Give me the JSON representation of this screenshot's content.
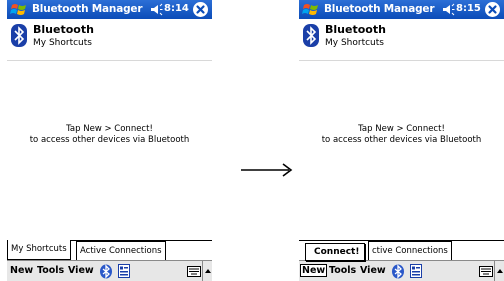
{
  "before": {
    "title": "Bluetooth Manager",
    "time": "8:14",
    "heading": "Bluetooth",
    "subheading": "My Shortcuts",
    "tip_line1": "Tap New > Connect!",
    "tip_line2": "to access other devices via Bluetooth",
    "tabs": [
      "My Shortcuts",
      "Active Connections"
    ],
    "menu": [
      "New",
      "Tools",
      "View"
    ]
  },
  "after": {
    "title": "Bluetooth Manager",
    "time": "8:15",
    "heading": "Bluetooth",
    "subheading": "My Shortcuts",
    "tip_line1": "Tap New > Connect!",
    "tip_line2": "to access other devices via Bluetooth",
    "tab_partial": "ctive Connections",
    "popup_item": "Connect!",
    "menu": [
      "New",
      "Tools",
      "View"
    ]
  },
  "icons": {
    "start": "windows-flag-icon",
    "volume": "speaker-icon",
    "close": "close-icon",
    "logo": "bluetooth-icon",
    "menu_bluetooth": "bluetooth-icon",
    "menu_settings": "settings-icon",
    "keyboard": "keyboard-icon",
    "transition": "right-arrow-icon"
  },
  "colors": {
    "title_bar": "#0b4cb8",
    "bluetooth_logo": "#1a3fa8",
    "menu_bar": "#e7e7e7"
  }
}
